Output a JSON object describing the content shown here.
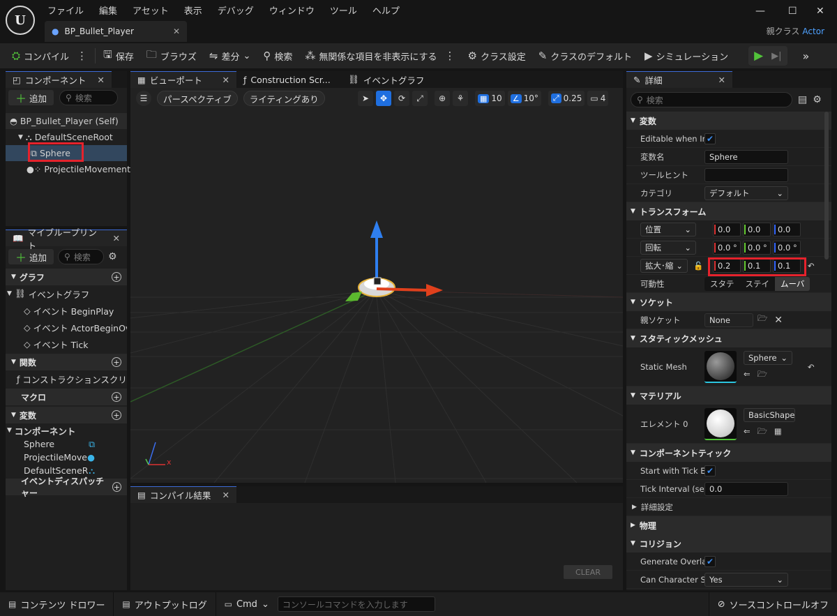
{
  "app": {
    "logo": "U",
    "menu": [
      "ファイル",
      "編集",
      "アセット",
      "表示",
      "デバッグ",
      "ウィンドウ",
      "ツール",
      "ヘルプ"
    ],
    "doc_tab": "BP_Bullet_Player",
    "parent_class_label": "親クラス",
    "parent_class_value": "Actor"
  },
  "toolbar": {
    "compile": "コンパイル",
    "save": "保存",
    "browse": "ブラウズ",
    "diff": "差分",
    "search": "検索",
    "hide_unrelated": "無関係な項目を非表示にする",
    "class_settings": "クラス設定",
    "class_defaults": "クラスのデフォルト",
    "simulation": "シミュレーション"
  },
  "components": {
    "tab": "コンポーネント",
    "add": "追加",
    "search_placeholder": "検索",
    "tree": {
      "self": "BP_Bullet_Player (Self)",
      "root": "DefaultSceneRoot",
      "sphere": "Sphere",
      "projectile": "ProjectileMovement"
    }
  },
  "myblueprint": {
    "tab": "マイブループリント",
    "add": "追加",
    "search_placeholder": "検索",
    "graph_section": "グラフ",
    "event_graph": "イベントグラフ",
    "events": [
      "イベント BeginPlay",
      "イベント ActorBeginOve",
      "イベント Tick"
    ],
    "functions_section": "関数",
    "construction_script": "コンストラクションスクリプ",
    "macros_section": "マクロ",
    "variables_section": "変数",
    "components_group": "コンポーネント",
    "component_vars": [
      "Sphere",
      "ProjectileMove",
      "DefaultSceneR"
    ],
    "dispatchers_section": "イベントディスパッチャー"
  },
  "viewport": {
    "tabs": [
      "ビューポート",
      "Construction Scr...",
      "イベントグラフ"
    ],
    "perspective": "パースペクティブ",
    "lighting": "ライティングあり",
    "grid_snap": "10",
    "rot_snap": "10°",
    "scale_snap": "0.25",
    "cam_speed": "4",
    "axis_x": "x"
  },
  "compile_results": {
    "tab": "コンパイル結果",
    "clear": "CLEAR"
  },
  "details": {
    "tab": "詳細",
    "search_placeholder": "検索",
    "variable": {
      "section": "変数",
      "editable_label": "Editable when In...",
      "name_label": "変数名",
      "name_value": "Sphere",
      "tooltip_label": "ツールヒント",
      "tooltip_value": "",
      "category_label": "カテゴリ",
      "category_value": "デフォルト"
    },
    "transform": {
      "section": "トランスフォーム",
      "location_label": "位置",
      "location": [
        "0.0",
        "0.0",
        "0.0"
      ],
      "rotation_label": "回転",
      "rotation": [
        "0.0 °",
        "0.0 °",
        "0.0 °"
      ],
      "scale_label": "拡大･縮",
      "scale": [
        "0.2",
        "0.1",
        "0.1"
      ],
      "mobility_label": "可動性",
      "mobility": [
        "スタテ",
        "ステイ",
        "ムーバ"
      ]
    },
    "sockets": {
      "section": "ソケット",
      "parent_label": "親ソケット",
      "parent_value": "None"
    },
    "static_mesh": {
      "section": "スタティックメッシュ",
      "label": "Static Mesh",
      "value": "Sphere"
    },
    "materials": {
      "section": "マテリアル",
      "label": "エレメント 0",
      "value": "BasicShapeM"
    },
    "component_tick": {
      "section": "コンポーネントティック",
      "start_label": "Start with Tick E...",
      "interval_label": "Tick Interval (se...",
      "interval_value": "0.0"
    },
    "advanced": "詳細設定",
    "physics": "物理",
    "collision": {
      "section": "コリジョン",
      "gen_overlap_label": "Generate Overla...",
      "can_step_label": "Can Character S...",
      "can_step_value": "Yes"
    }
  },
  "statusbar": {
    "content_drawer": "コンテンツ ドロワー",
    "output_log": "アウトプットログ",
    "cmd": "Cmd",
    "console_placeholder": "コンソールコマンドを入力します",
    "source_control": "ソースコントロールオフ"
  },
  "colors": {
    "accent_blue": "#1f6fe0",
    "play_green": "#52c23a",
    "highlight_red": "#e5222c",
    "selection": "#32475e"
  }
}
